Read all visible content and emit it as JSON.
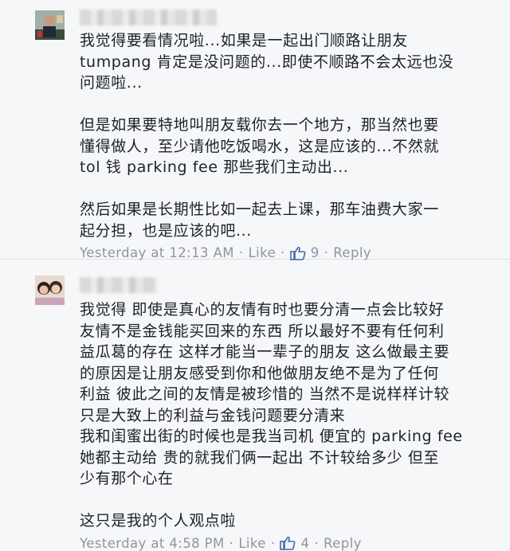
{
  "comments": [
    {
      "name_redacted": true,
      "lines": [
        "我觉得要看情况啦...如果是一起出门顺路让朋友",
        "tumpang 肯定是没问题的...即使不顺路不会太远也没",
        "问题啦...",
        "",
        "但是如果要特地叫朋友载你去一个地方，那当然也要",
        "懂得做人，至少请他吃饭喝水，这是应该的...不然就",
        "tol 钱 parking fee 那些我们主动出...",
        "",
        "然后如果是长期性比如一起去上课，那车油费大家一",
        "起分担，也是应该的吧..."
      ],
      "time": "Yesterday at 12:13 AM",
      "like_label": "Like",
      "like_count": "9",
      "reply_label": "Reply"
    },
    {
      "name_redacted": true,
      "lines": [
        "我觉得 即使是真心的友情有时也要分清一点会比较好",
        "友情不是金钱能买回来的东西 所以最好不要有任何利",
        "益瓜葛的存在 这样才能当一辈子的朋友 这么做最主要",
        "的原因是让朋友感受到你和他做朋友绝不是为了任何",
        "利益 彼此之间的友情是被珍惜的 当然不是说样样计较",
        "只是大致上的利益与金钱问题要分清来",
        "我和闺蜜出街的时候也是我当司机 便宜的 parking fee",
        "她都主动给 贵的就我们俩一起出 不计较给多少 但至",
        "少有那个心在",
        "",
        "这只是我的个人观点啦"
      ],
      "time": "Yesterday at 4:58 PM",
      "like_label": "Like",
      "like_count": "4",
      "reply_label": "Reply"
    }
  ],
  "separator": "·",
  "colors": {
    "background": "#f6f7f9",
    "text": "#1d2129",
    "meta": "#90949c",
    "like_blue": "#4267b2"
  },
  "icons": {
    "like": "thumbs-up-icon"
  }
}
